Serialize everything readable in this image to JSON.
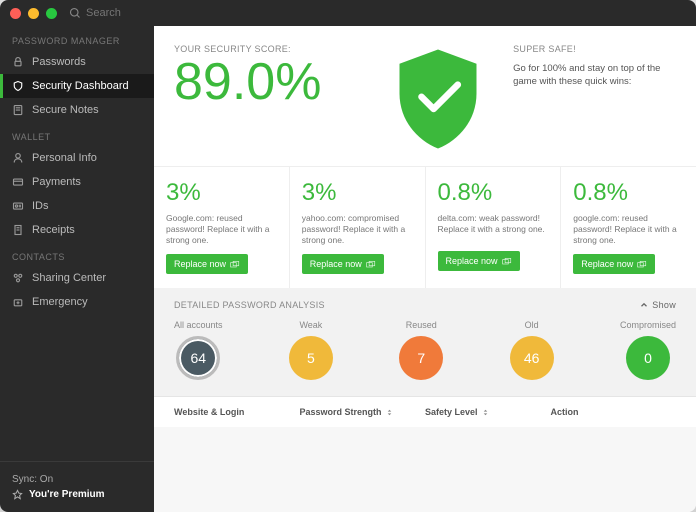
{
  "search": {
    "placeholder": "Search"
  },
  "sidebar": {
    "groups": [
      {
        "title": "PASSWORD MANAGER",
        "items": [
          {
            "label": "Passwords"
          },
          {
            "label": "Security Dashboard"
          },
          {
            "label": "Secure Notes"
          }
        ]
      },
      {
        "title": "WALLET",
        "items": [
          {
            "label": "Personal Info"
          },
          {
            "label": "Payments"
          },
          {
            "label": "IDs"
          },
          {
            "label": "Receipts"
          }
        ]
      },
      {
        "title": "CONTACTS",
        "items": [
          {
            "label": "Sharing Center"
          },
          {
            "label": "Emergency"
          }
        ]
      }
    ],
    "footer": {
      "sync": "Sync: On",
      "premium": "You're Premium"
    }
  },
  "hero": {
    "score_label": "YOUR SECURITY SCORE:",
    "score": "89.0%",
    "safe_tag": "SUPER SAFE!",
    "safe_msg": "Go for 100% and stay on top of the game with these quick wins:"
  },
  "quick_wins": [
    {
      "pct": "3%",
      "text": "Google.com: reused password! Replace it with a strong one.",
      "btn": "Replace now"
    },
    {
      "pct": "3%",
      "text": "yahoo.com: compromised password! Replace it with a strong one.",
      "btn": "Replace now"
    },
    {
      "pct": "0.8%",
      "text": "delta.com: weak password! Replace it with a strong one.",
      "btn": "Replace now"
    },
    {
      "pct": "0.8%",
      "text": "google.com: reused password! Replace it with a strong one.",
      "btn": "Replace now"
    }
  ],
  "analysis": {
    "title": "DETAILED PASSWORD ANALYSIS",
    "show": "Show",
    "items": [
      {
        "label": "All accounts",
        "value": "64",
        "color": "#4a5a63",
        "ring": true
      },
      {
        "label": "Weak",
        "value": "5",
        "color": "#f0b93a"
      },
      {
        "label": "Reused",
        "value": "7",
        "color": "#f07a3a"
      },
      {
        "label": "Old",
        "value": "46",
        "color": "#f0b93a"
      },
      {
        "label": "Compromised",
        "value": "0",
        "color": "#3cb93c"
      }
    ]
  },
  "table": {
    "cols": [
      "Website & Login",
      "Password Strength",
      "Safety Level",
      "Action"
    ]
  },
  "colors": {
    "accent": "#3cb93c"
  }
}
